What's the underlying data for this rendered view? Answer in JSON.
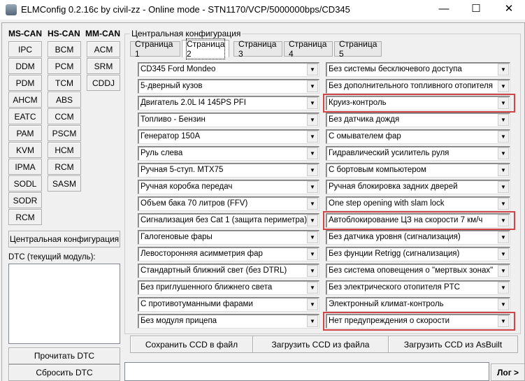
{
  "window": {
    "title": "ELMConfig 0.2.16c by civil-zz - Online mode - STN1170/VCP/5000000bps/CD345",
    "minimize": "—",
    "maximize": "☐",
    "close": "✕"
  },
  "modules": {
    "ms_can": {
      "label": "MS-CAN",
      "items": [
        "IPC",
        "DDM",
        "PDM",
        "AHCM",
        "EATC",
        "PAM",
        "KVM",
        "IPMA",
        "SODL",
        "SODR",
        "RCM"
      ]
    },
    "hs_can": {
      "label": "HS-CAN",
      "items": [
        "BCM",
        "PCM",
        "TCM",
        "ABS",
        "CCM",
        "PSCM",
        "HCM",
        "RCM",
        "SASM"
      ]
    },
    "mm_can": {
      "label": "MM-CAN",
      "items": [
        "ACM",
        "SRM",
        "CDDJ"
      ]
    }
  },
  "central_config_button": "Центральная конфигурация",
  "dtc": {
    "label": "DTC (текущий модуль):",
    "read": "Прочитать DTC",
    "reset": "Сбросить DTC"
  },
  "group_title": "Центральная конфигурация",
  "tabs": [
    "Страница 1",
    "Страница 2",
    "Страница 3",
    "Страница 4",
    "Страница 5"
  ],
  "active_tab": "Страница 2",
  "left_options": [
    "CD345 Ford Mondeo",
    "5-дверный кузов",
    "Двигатель 2.0L I4 145PS PFI",
    "Топливо - Бензин",
    "Генератор 150А",
    "Руль слева",
    "Ручная 5-ступ. MTX75",
    "Ручная коробка передач",
    "Объем бака 70 литров (FFV)",
    "Сигнализация без Cat 1 (защита периметра)",
    "Галогеновые фары",
    "Левосторонняя асимметрия фар",
    "Стандартный ближний свет (без DTRL)",
    "Без приглушенного ближнего света",
    "С противотуманными фарами",
    "Без модуля прицепа"
  ],
  "right_options": [
    "Без системы бесключевого доступа",
    "Без дополнительного топливного отопителя",
    "Круиз-контроль",
    "Без датчика дождя",
    "С омывателем фар",
    "Гидравлический усилитель руля",
    "С бортовым компьютером",
    "Ручная блокировка задних дверей",
    "One step opening with slam lock",
    "Автоблокирование ЦЗ на скорости 7 км/ч",
    "Без датчика уровня (сигнализация)",
    "Без фунции Retrigg (сигнализация)",
    "Без система оповещения о \"мертвых зонах\"",
    "Без электрического отопителя PTC",
    "Электронный климат-контроль",
    "Нет предупреждения о скорости"
  ],
  "highlighted_right_rows": [
    2,
    9,
    15
  ],
  "highlight_color": "#d0454a",
  "actions": {
    "save": "Сохранить CCD в файл",
    "load_file": "Загрузить CCD из файла",
    "load_asbuilt": "Загрузить CCD из AsBuilt"
  },
  "log_button": "Лог >"
}
